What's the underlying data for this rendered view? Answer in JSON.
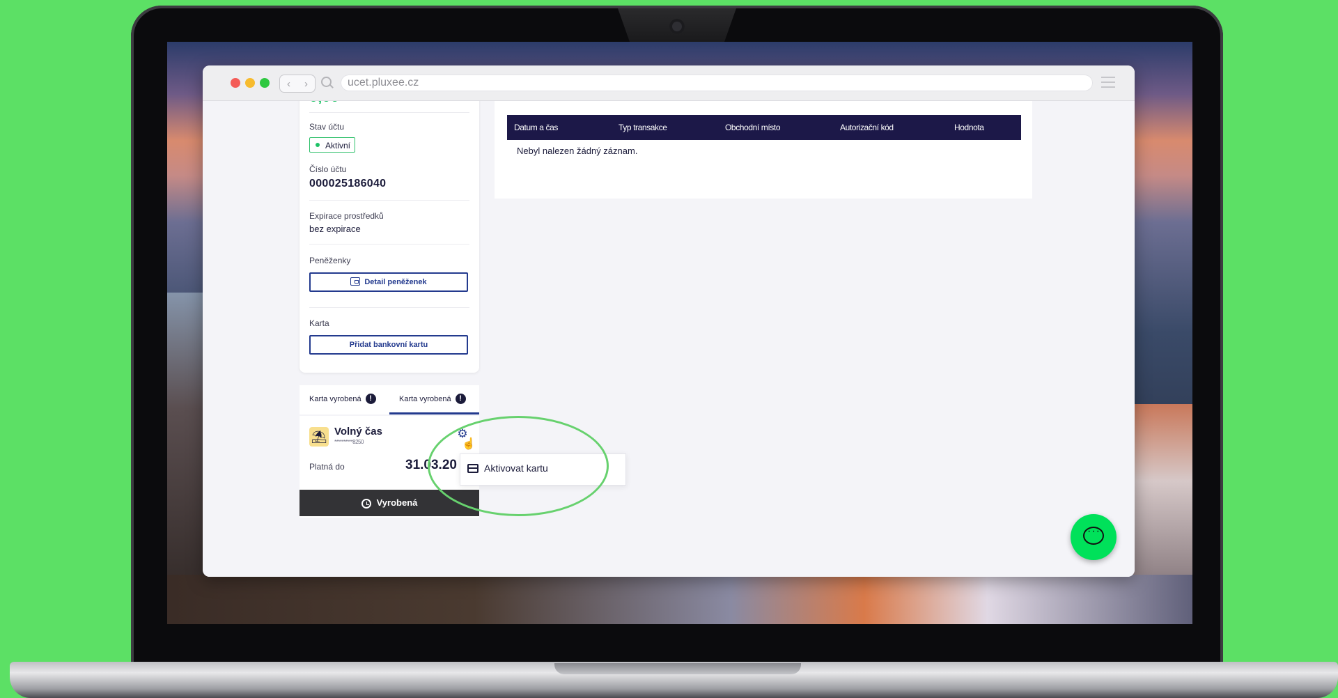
{
  "browser": {
    "url": "ucet.pluxee.cz",
    "nav_back": "‹",
    "nav_forward": "›"
  },
  "account": {
    "status_label": "Stav účtu",
    "status_value": "Aktivní",
    "number_label": "Číslo účtu",
    "number_value": "000025186040",
    "expiry_label": "Expirace prostředků",
    "expiry_value": "bez expirace",
    "wallets_label": "Peněženky",
    "wallets_button": "Detail peněženek",
    "card_label": "Karta",
    "add_card_button": "Přidat bankovní kartu"
  },
  "card_tabs": [
    {
      "label": "Karta vyrobená",
      "alert": "!"
    },
    {
      "label": "Karta vyrobená",
      "alert": "!"
    }
  ],
  "card": {
    "title": "Volný čas",
    "masked_number": "**********8250",
    "valid_label": "Platná do",
    "valid_date": "31.03.20",
    "status": "Vyrobená"
  },
  "context_menu": {
    "items": [
      {
        "label": "Aktivovat kartu"
      }
    ]
  },
  "transactions": {
    "columns": [
      "Datum a čas",
      "Typ transakce",
      "Obchodní místo",
      "Autorizační kód",
      "Hodnota"
    ],
    "empty_message": "Nebyl nalezen žádný záznam."
  },
  "colors": {
    "background": "#5ce065",
    "brand_navy": "#1c1848",
    "button_blue": "#233a8e",
    "accent_green": "#00e15a",
    "highlight": "#67d16e"
  }
}
